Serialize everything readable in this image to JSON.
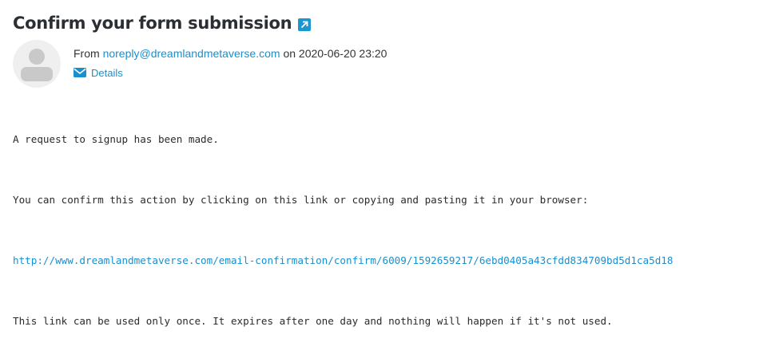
{
  "email": {
    "subject": "Confirm your form submission",
    "popout_icon": "external-link-icon",
    "avatar_icon": "user-avatar-icon",
    "from_prefix": "From",
    "from_email": "noreply@dreamlandmetaverse.com",
    "on_word": "on",
    "timestamp": "2020-06-20 23:20",
    "details_label": "Details",
    "details_icon": "envelope-icon"
  },
  "body": {
    "line1": "A request to signup has been made.",
    "line2": "You can confirm this action by clicking on this link or copying and pasting it in your browser:",
    "link": "http://www.dreamlandmetaverse.com/email-confirmation/confirm/6009/1592659217/6ebd0405a43cfdd834709bd5d1ca5d18",
    "line4": "This link can be used only once. It expires after one day and nothing will happen if it's not used."
  },
  "colors": {
    "accent": "#1a8fcd",
    "title": "#2b2f33",
    "avatar_bg": "#efefef",
    "avatar_fg": "#c9c9c9"
  }
}
